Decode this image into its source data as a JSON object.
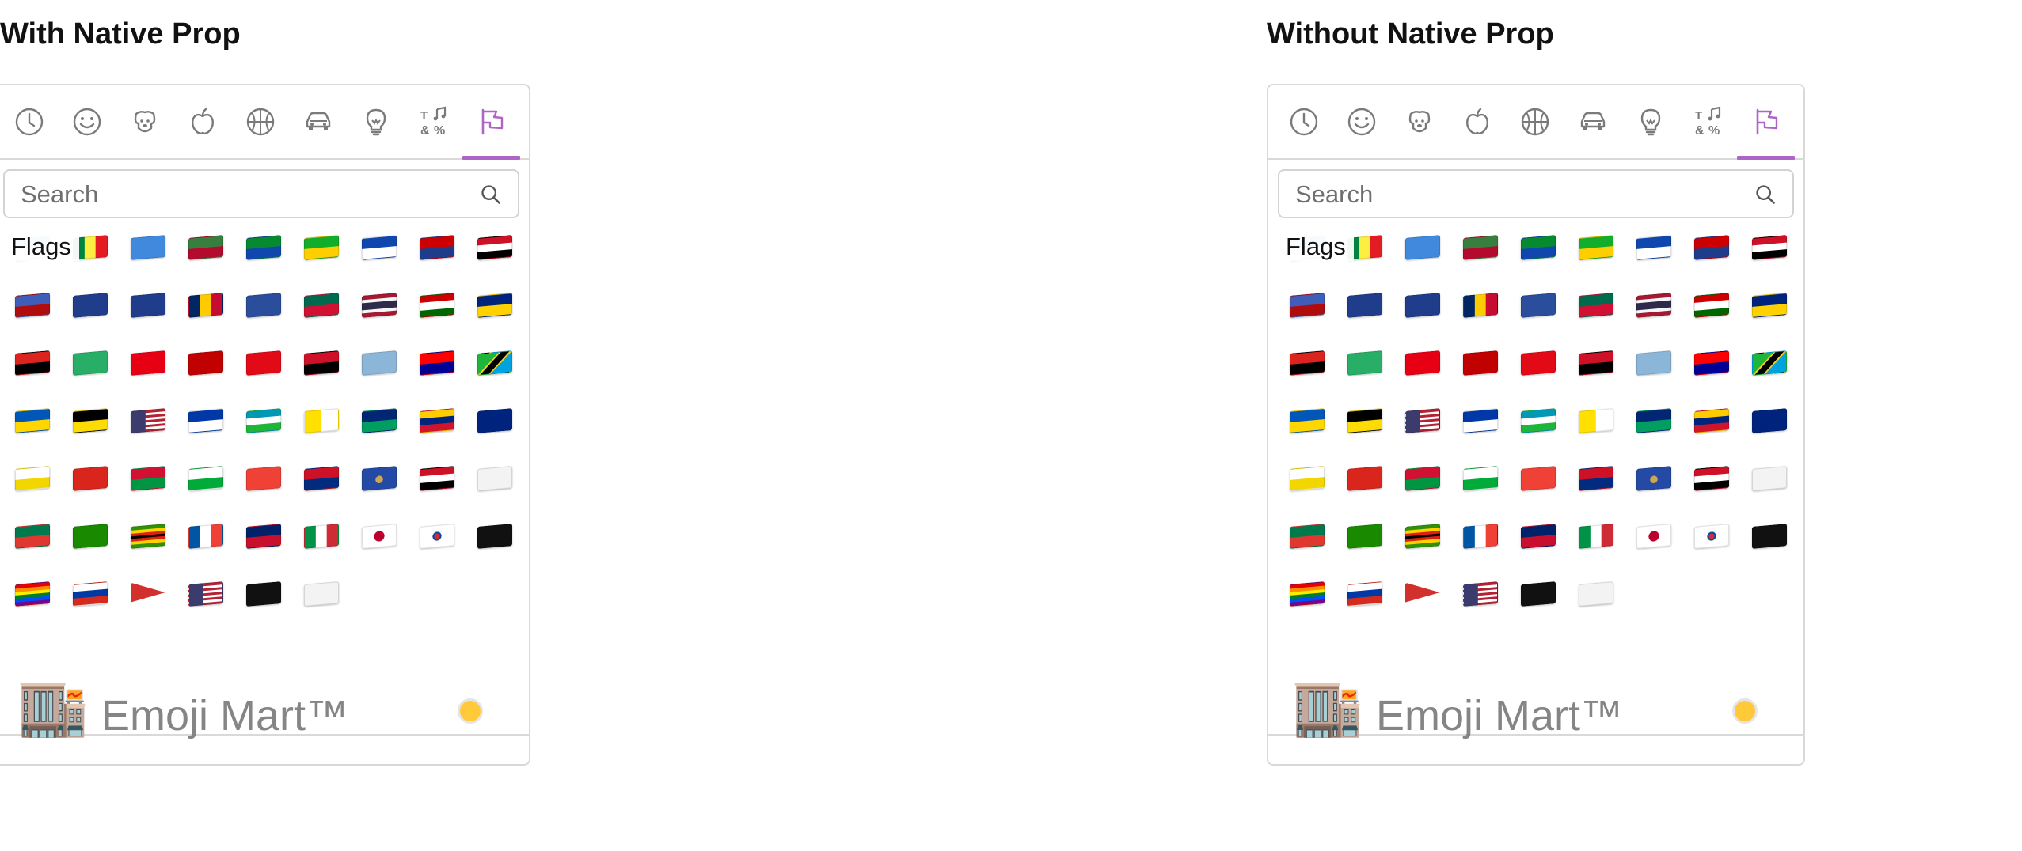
{
  "pickers": [
    {
      "title": "With Native Prop",
      "search": {
        "placeholder": "Search"
      },
      "category_label": "Flags",
      "preview": {
        "emoji": "🏬",
        "name": "Emoji Mart™"
      }
    },
    {
      "title": "Without Native Prop",
      "search": {
        "placeholder": "Search"
      },
      "category_label": "Flags",
      "preview": {
        "emoji": "🏬",
        "name": "Emoji Mart™"
      }
    }
  ],
  "anchors": [
    {
      "name": "recent",
      "icon": "clock-icon"
    },
    {
      "name": "people",
      "icon": "smiley-icon"
    },
    {
      "name": "nature",
      "icon": "dog-icon"
    },
    {
      "name": "foods",
      "icon": "apple-icon"
    },
    {
      "name": "activity",
      "icon": "basketball-icon"
    },
    {
      "name": "places",
      "icon": "car-icon"
    },
    {
      "name": "objects",
      "icon": "lightbulb-icon"
    },
    {
      "name": "symbols",
      "icon": "symbols-icon"
    },
    {
      "name": "flags",
      "icon": "flag-icon",
      "selected": true
    }
  ],
  "colors": {
    "accent": "#ae65c5",
    "border": "#d9d9d9",
    "skin_tone": "#ffc93a"
  },
  "flags": [
    [
      "San Marino",
      "#5eb6e4",
      "#ffffff"
    ],
    [
      "Senegal",
      "#00853f",
      "#fdef42"
    ],
    [
      "Somalia",
      "#4189dd",
      "#4189dd"
    ],
    [
      "Suriname",
      "#377e3f",
      "#b40a2d"
    ],
    [
      "South Sudan",
      "#078930",
      "#0f47af"
    ],
    [
      "São Tomé",
      "#12ad2b",
      "#ffce00"
    ],
    [
      "El Salvador",
      "#0f47af",
      "#ffffff"
    ],
    [
      "Sint Maarten",
      "#cc0000",
      "#1e3c8a"
    ],
    [
      "Syria",
      "#ce1126",
      "#ffffff"
    ],
    [
      "Eswatini",
      "#3e5eb9",
      "#b10c0c"
    ],
    [
      "Turks & Caicos",
      "#1f3d8a",
      "#1f3d8a"
    ],
    [
      "French Southern",
      "#1f3d8a",
      "#1f3d8a"
    ],
    [
      "Chad",
      "#002664",
      "#fecb00"
    ],
    [
      "Tokelau",
      "#2a4e9c",
      "#2a4e9c"
    ],
    [
      "Togo",
      "#006a4e",
      "#d21034"
    ],
    [
      "Thailand",
      "#a51931",
      "#2d2a4a"
    ],
    [
      "Tajikistan",
      "#cc0000",
      "#ffffff"
    ],
    [
      "Tokelau2",
      "#00247d",
      "#ffd100"
    ],
    [
      "Timor-Leste",
      "#dc241f",
      "#000000"
    ],
    [
      "Turkmenistan",
      "#28ae66",
      "#28ae66"
    ],
    [
      "Tunisia",
      "#e70013",
      "#e70013"
    ],
    [
      "Tonga",
      "#c10000",
      "#c10000"
    ],
    [
      "Türkiye",
      "#e30a17",
      "#e30a17"
    ],
    [
      "Trinidad",
      "#ce1126",
      "#000000"
    ],
    [
      "Tuvalu",
      "#8cb6d8",
      "#8cb6d8"
    ],
    [
      "Taiwan",
      "#fe0000",
      "#000095"
    ],
    [
      "Tanzania",
      "#1eb53a",
      "#00a3dd"
    ],
    [
      "Ukraine",
      "#0057b7",
      "#ffd700"
    ],
    [
      "Uganda",
      "#000000",
      "#fcdc04"
    ],
    [
      "United States",
      "#b22234",
      "#3c3b6e"
    ],
    [
      "Uruguay",
      "#0038a8",
      "#ffffff"
    ],
    [
      "Uzbekistan",
      "#0099b5",
      "#1eb53a"
    ],
    [
      "Vatican",
      "#ffe000",
      "#ffffff"
    ],
    [
      "St. Vincent",
      "#002674",
      "#009e60"
    ],
    [
      "Venezuela",
      "#ffcc00",
      "#cf142b"
    ],
    [
      "British Virgin Is.",
      "#00247d",
      "#00247d"
    ],
    [
      "US Virgin Is.",
      "#ffffff",
      "#f2d600"
    ],
    [
      "Vietnam",
      "#da251d",
      "#da251d"
    ],
    [
      "Vanuatu",
      "#d21034",
      "#009543"
    ],
    [
      "Wales",
      "#ffffff",
      "#00ab39"
    ],
    [
      "Wallis & Futuna",
      "#ef4135",
      "#ef4135"
    ],
    [
      "Samoa",
      "#ce1126",
      "#002b7f"
    ],
    [
      "Kosovo",
      "#244aa5",
      "#244aa5"
    ],
    [
      "Yemen",
      "#ce1126",
      "#000000"
    ],
    [
      "Mayotte",
      "#ffffff",
      "#ffffff"
    ],
    [
      "South Africa",
      "#007a4d",
      "#de3831"
    ],
    [
      "Zambia",
      "#198a00",
      "#198a00"
    ],
    [
      "Zimbabwe",
      "#319208",
      "#ffd200"
    ],
    [
      "France",
      "#0055a4",
      "#ef4135"
    ],
    [
      "United Kingdom",
      "#012169",
      "#c8102e"
    ],
    [
      "Italy",
      "#009246",
      "#ce2b37"
    ],
    [
      "Japan",
      "#ffffff",
      "#ffffff"
    ],
    [
      "South Korea",
      "#ffffff",
      "#ffffff"
    ],
    [
      "Pirate",
      "#111111",
      "#111111"
    ],
    [
      "Rainbow",
      "#e40303",
      "#004dff"
    ],
    [
      "Russia",
      "#ffffff",
      "#d52b1e"
    ],
    [
      "Triangular",
      "#d2302c",
      "#d2302c"
    ],
    [
      "United States2",
      "#b22234",
      "#3c3b6e"
    ],
    [
      "Black",
      "#111111",
      "#111111"
    ],
    [
      "White",
      "#f3f3f3",
      "#f3f3f3"
    ]
  ]
}
